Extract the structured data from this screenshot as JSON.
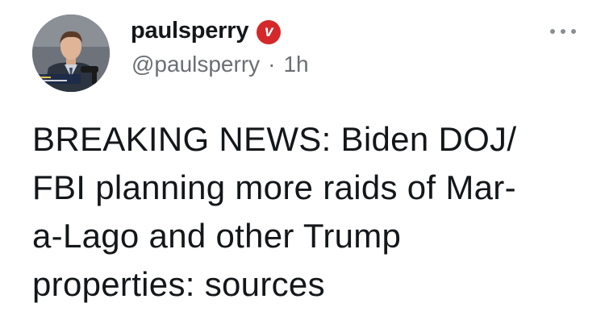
{
  "author": {
    "display_name": "paulsperry",
    "verified_badge_letter": "v",
    "handle": "@paulsperry",
    "separator": "·",
    "timestamp": "1h",
    "badge_color": "#d4282b"
  },
  "tweet": {
    "text": "BREAKING NEWS: Biden DOJ/\nFBI planning more raids of Mar-\na-Lago and other Trump\nproperties: sources"
  },
  "icons": {
    "more": "more-options-icon",
    "avatar": "profile-photo"
  }
}
